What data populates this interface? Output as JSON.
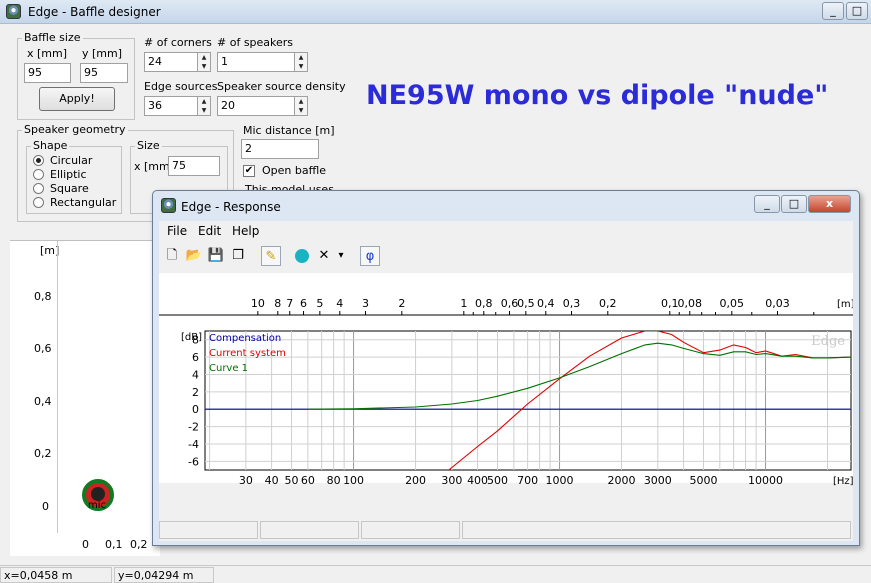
{
  "main_window": {
    "title": "Edge - Baffle designer",
    "controls": [
      "_",
      "□",
      "x"
    ],
    "baffle_size": {
      "group_label": "Baffle size",
      "x_label": "x [mm]",
      "y_label": "y [mm]",
      "x_value": "95",
      "y_value": "95",
      "apply_label": "Apply!"
    },
    "corners": {
      "label": "# of corners",
      "value": "24"
    },
    "speakers": {
      "label": "# of speakers",
      "value": "1"
    },
    "edge_sources": {
      "label": "Edge sources",
      "value": "36"
    },
    "source_density": {
      "label": "Speaker source density",
      "value": "20"
    },
    "mic_distance": {
      "label": "Mic distance [m]",
      "value": "2"
    },
    "open_baffle": {
      "label": "Open baffle",
      "checked": true
    },
    "model_note": "This model uses",
    "speaker_geometry": {
      "group_label": "Speaker geometry",
      "shape_label": "Shape",
      "shapes": [
        "Circular",
        "Elliptic",
        "Square",
        "Rectangular"
      ],
      "selected_shape": "Circular",
      "size_label": "Size",
      "size_field_label": "x [mm]",
      "size_value": "75"
    },
    "annotation": "NE95W mono vs dipole \"nude\"",
    "baffle_view": {
      "y_unit": "[m]",
      "y_ticks": [
        "0,8",
        "0,6",
        "0,4",
        "0,2",
        "0"
      ],
      "x_ticks": [
        "0",
        "0,1",
        "0,2"
      ],
      "mic_label": "mic"
    },
    "status": {
      "x": "x=0,0458 m",
      "y": "y=0,04294 m"
    }
  },
  "response_window": {
    "title": "Edge - Response",
    "controls": [
      "_",
      "□",
      "x"
    ],
    "menu": [
      "File",
      "Edit",
      "Help"
    ],
    "toolbar": {
      "new_icon": "new-document-icon",
      "open_icon": "open-folder-icon",
      "save_icon": "floppy-disk-icon",
      "copy_icon": "copy-icon",
      "pen_icon": "pen-icon",
      "curve_icon": "teal-person-icon",
      "delete_glyph": "✕",
      "dropdown_glyph": "▾",
      "phi_glyph": "φ"
    },
    "watermark": "Edge"
  },
  "chart_data": {
    "type": "line",
    "x_scale": "log",
    "xlim": [
      19,
      26000
    ],
    "ylim": [
      -7,
      9
    ],
    "xlabel": "[Hz]",
    "ylabel": "[dB]",
    "top_axis_label": "[m]",
    "x_ticks": [
      30,
      40,
      50,
      60,
      80,
      100,
      200,
      300,
      400,
      500,
      700,
      1000,
      2000,
      3000,
      5000,
      10000
    ],
    "x_tick_labels": [
      "30",
      "40",
      "50",
      "60",
      "80",
      "100",
      "200",
      "300",
      "400",
      "500",
      "700",
      "1000",
      "2000",
      "3000",
      "5000",
      "10000"
    ],
    "y_ticks": [
      8,
      6,
      4,
      2,
      0,
      -2,
      -4,
      -6
    ],
    "y_tick_labels": [
      "8",
      "6",
      "4",
      "2",
      "0",
      "-2",
      "-4",
      "-6"
    ],
    "top_ticks_m": [
      10,
      8,
      7,
      6,
      5,
      4,
      3,
      2,
      1,
      0.8,
      0.6,
      0.5,
      0.4,
      0.3,
      0.2,
      0.1,
      0.08,
      0.05,
      0.03
    ],
    "top_tick_labels": [
      "10",
      "8",
      "7",
      "6",
      "5",
      "4",
      "3",
      "2",
      "1",
      "0,8",
      "0,6",
      "0,5",
      "0,4",
      "0,3",
      "0,2",
      "0,1",
      "0,08",
      "0,05",
      "0,03"
    ],
    "grid": true,
    "legend_position": "top-left",
    "series": [
      {
        "name": "Compensation",
        "color": "#0000a0",
        "x": [
          19,
          26000
        ],
        "y": [
          0,
          0
        ]
      },
      {
        "name": "Current system",
        "color": "#e00000",
        "x": [
          290,
          400,
          500,
          700,
          1000,
          1400,
          2000,
          2600,
          3000,
          3500,
          4000,
          5000,
          6000,
          7000,
          8000,
          9000,
          10000,
          12000,
          14000,
          17000,
          20000,
          26000
        ],
        "y": [
          -7,
          -4.3,
          -2.5,
          0.6,
          3.5,
          6.1,
          8.2,
          9.0,
          9.0,
          8.6,
          7.7,
          6.5,
          6.8,
          7.4,
          7.1,
          6.5,
          6.7,
          6.1,
          6.3,
          5.9,
          5.9,
          6.0
        ]
      },
      {
        "name": "Curve 1",
        "color": "#007000",
        "x": [
          60,
          100,
          200,
          300,
          400,
          500,
          700,
          1000,
          1400,
          2000,
          2600,
          3000,
          3500,
          4000,
          5000,
          6000,
          7000,
          8000,
          9000,
          10000,
          12000,
          14000,
          17000,
          20000,
          26000
        ],
        "y": [
          0,
          0.05,
          0.25,
          0.6,
          1.0,
          1.5,
          2.4,
          3.6,
          4.9,
          6.4,
          7.4,
          7.6,
          7.4,
          7.0,
          6.4,
          6.2,
          6.6,
          6.6,
          6.3,
          6.4,
          6.1,
          6.1,
          5.9,
          5.9,
          6.0
        ]
      }
    ]
  }
}
